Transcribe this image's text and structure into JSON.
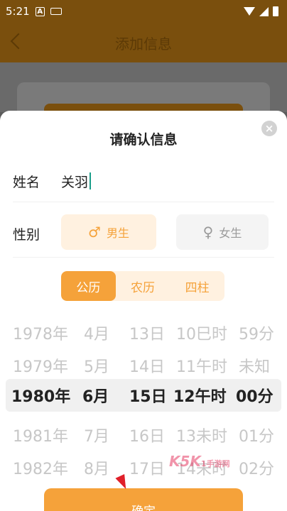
{
  "status_bar": {
    "time": "5:21",
    "a_badge": "A"
  },
  "header": {
    "title": "添加信息"
  },
  "sheet": {
    "title": "请确认信息",
    "close": "×",
    "name_label": "姓名",
    "name_value": "关羽",
    "gender_label": "性别",
    "gender_male": {
      "symbol": "♂",
      "label": "男生"
    },
    "gender_female": {
      "symbol": "♀",
      "label": "女生"
    },
    "calendar_tabs": [
      "公历",
      "农历",
      "四柱"
    ],
    "picker_rows": [
      [
        "1978年",
        "4月",
        "13日",
        "10巳时",
        "59分"
      ],
      [
        "1979年",
        "5月",
        "14日",
        "11午时",
        "未知"
      ],
      [
        "1980年",
        "6月",
        "15日",
        "12午时",
        "00分"
      ],
      [
        "1981年",
        "7月",
        "16日",
        "13未时",
        "01分"
      ],
      [
        "1982年",
        "8月",
        "17日",
        "14未时",
        "02分"
      ]
    ],
    "watermark": {
      "main": "K5K",
      "sub": "1手游网"
    },
    "confirm_label": "确定"
  },
  "colors": {
    "accent": "#f5a23a",
    "header_bg": "#7a4f0d",
    "accent_light": "#fff1e0"
  }
}
